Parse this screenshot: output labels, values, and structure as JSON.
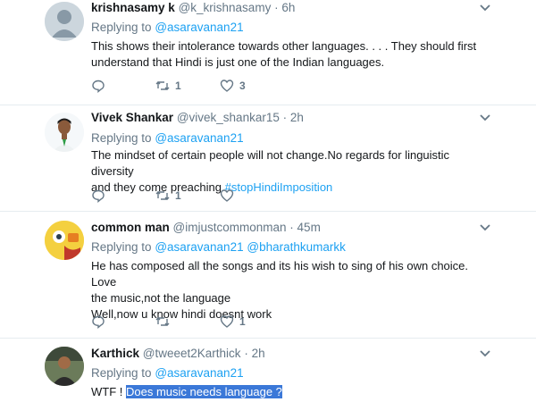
{
  "tweets": [
    {
      "name": "krishnasamy k",
      "handle": "@k_krishnasamy",
      "sep": "·",
      "time": "6h",
      "replying_label": "Replying to",
      "replying_to": [
        "@asaravanan21"
      ],
      "text_lines": [
        "This shows their intolerance towards other languages. . . . They should first",
        "understand that Hindi is just one of the Indian languages."
      ],
      "retweets": "1",
      "likes": "3"
    },
    {
      "name": "Vivek Shankar",
      "handle": "@vivek_shankar15",
      "sep": "·",
      "time": "2h",
      "replying_label": "Replying to",
      "replying_to": [
        "@asaravanan21"
      ],
      "text_lines": [
        "The mindset of certain people will not change.No regards for linguistic diversity",
        "and they come preaching"
      ],
      "hashtag": "#stopHindiImposition",
      "retweets": "1",
      "likes": ""
    },
    {
      "name": "common man",
      "handle": "@imjustcommonman",
      "sep": "·",
      "time": "45m",
      "replying_label": "Replying to",
      "replying_to": [
        "@asaravanan21",
        "@bharathkumarkk"
      ],
      "text_lines": [
        "He has composed all the songs and its his wish to sing of his own choice. Love",
        "the music,not the language",
        "Well,now u know hindi doesnt work"
      ],
      "retweets": "",
      "likes": "1"
    },
    {
      "name": "Karthick",
      "handle": "@tweeet2Karthick",
      "sep": "·",
      "time": "2h",
      "replying_label": "Replying to",
      "replying_to": [
        "@asaravanan21"
      ],
      "text_prefix": "WTF !",
      "text_highlight": "Does music needs language ?"
    }
  ],
  "icons": [
    "reply-icon",
    "retweet-icon",
    "like-icon",
    "chevron-down-icon"
  ],
  "colors": {
    "link": "#1da1f2",
    "muted": "#657786",
    "highlight": "#3b78d8"
  }
}
